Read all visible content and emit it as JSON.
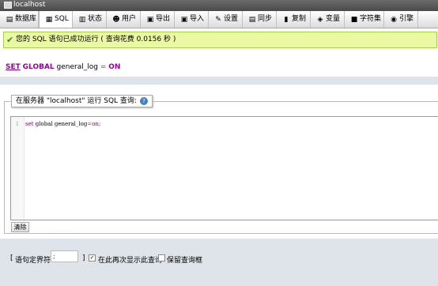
{
  "window": {
    "title": "localhost"
  },
  "tabs": [
    {
      "label": "数据库",
      "icon": "database-icon",
      "glyph": "▤"
    },
    {
      "label": "SQL",
      "icon": "sql-icon",
      "glyph": "▦"
    },
    {
      "label": "状态",
      "icon": "status-icon",
      "glyph": "▥"
    },
    {
      "label": "用户",
      "icon": "users-icon",
      "glyph": "☻"
    },
    {
      "label": "导出",
      "icon": "export-icon",
      "glyph": "▣"
    },
    {
      "label": "导入",
      "icon": "import-icon",
      "glyph": "▣"
    },
    {
      "label": "设置",
      "icon": "settings-icon",
      "glyph": "✎"
    },
    {
      "label": "同步",
      "icon": "sync-icon",
      "glyph": "▤"
    },
    {
      "label": "复制",
      "icon": "replication-icon",
      "glyph": "▮"
    },
    {
      "label": "变量",
      "icon": "variables-icon",
      "glyph": "◈"
    },
    {
      "label": "字符集",
      "icon": "charset-icon",
      "glyph": "■"
    },
    {
      "label": "引擎",
      "icon": "engines-icon",
      "glyph": "◉"
    }
  ],
  "active_tab": "SQL",
  "message": {
    "text": "您的 SQL 语句已成功运行 ( 查询花费 0.0156 秒 )",
    "icon": "success-check-icon"
  },
  "executed_sql": {
    "kw1": "SET",
    "kw2": "GLOBAL",
    "name": "general_log",
    "op": "=",
    "value": "ON"
  },
  "query_box": {
    "legend": "在服务器 \"localhost\" 运行 SQL 查询:",
    "help_icon": "help-icon",
    "line_number": "1",
    "code": {
      "kw1": "set",
      "kw2": "global",
      "name": "general_log",
      "op": "=",
      "value": "on;"
    },
    "clear_label": "清除"
  },
  "options": {
    "bracket_open": "[",
    "delimiter_label": "语句定界符",
    "delimiter_value": ";",
    "bracket_close": "]",
    "show_again_label": "在此再次显示此查询",
    "show_again_checked": true,
    "retain_label": "保留查询框",
    "retain_checked": false
  },
  "colors": {
    "success_bg": "#ebf8a4",
    "success_border": "#a2d246",
    "keyword": "#990099",
    "band": "#dfe4ea"
  }
}
